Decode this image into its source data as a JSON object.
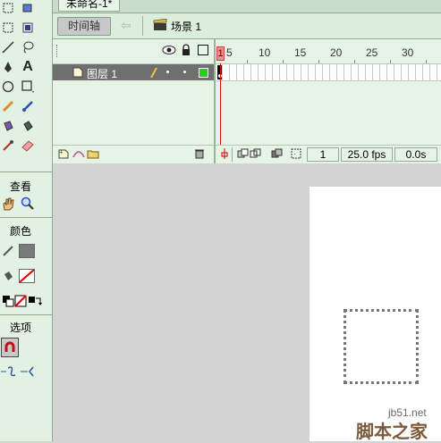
{
  "document": {
    "tab_title": "未命名-1*"
  },
  "toolbox": {
    "view_label": "查看",
    "colors_label": "颜色",
    "options_label": "选项",
    "stroke_color": "#7a7a7a",
    "fill_color": "none"
  },
  "editbar": {
    "timeline_button": "时间轴",
    "scene_label": "场景 1"
  },
  "timeline": {
    "layer_name": "图层 1",
    "frame_numbers": [
      "1",
      "5",
      "10",
      "15",
      "20",
      "25",
      "30"
    ],
    "current_frame": "1",
    "fps": "25.0 fps",
    "elapsed": "0.0s"
  },
  "watermark": {
    "url": "jb51.net",
    "name": "脚本之家"
  },
  "colors": {
    "panel_green": "#e6f4e6",
    "layer_row": "#6f6f6f",
    "playhead": "#ef8c8c",
    "stage_bg": "#d3d3d3"
  }
}
